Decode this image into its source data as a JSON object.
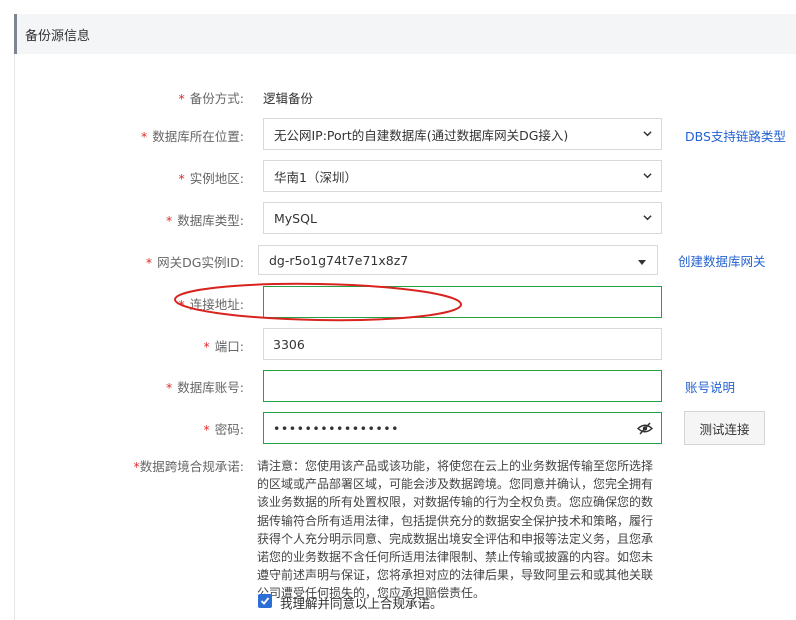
{
  "section": {
    "title": "备份源信息"
  },
  "form": {
    "backup_method": {
      "required": "*",
      "label": "备份方式:",
      "value": "逻辑备份"
    },
    "db_location": {
      "required": "*",
      "label": "数据库所在位置:",
      "value": "无公网IP:Port的自建数据库(通过数据库网关DG接入)",
      "link": "DBS支持链路类型"
    },
    "region": {
      "required": "*",
      "label": "实例地区:",
      "value": "华南1（深圳）"
    },
    "db_type": {
      "required": "*",
      "label": "数据库类型:",
      "value": "MySQL"
    },
    "gateway_id": {
      "required": "*",
      "label": "网关DG实例ID:",
      "value": "dg-r5o1g74t7e71x8z7",
      "link": "创建数据库网关"
    },
    "address": {
      "required": "*",
      "label": "连接地址:",
      "value": ""
    },
    "port": {
      "required": "*",
      "label": "端口:",
      "value": "3306"
    },
    "account": {
      "required": "*",
      "label": "数据库账号:",
      "value": "",
      "link": "账号说明"
    },
    "password": {
      "required": "*",
      "label": "密码:",
      "value": "••••••••••••••••"
    },
    "test_button": "测试连接",
    "compliance": {
      "required": "*",
      "label": "数据跨境合规承诺:",
      "text": "请注意：您使用该产品或该功能，将使您在云上的业务数据传输至您所选择的区域或产品部署区域，可能会涉及数据跨境。您同意并确认，您完全拥有该业务数据的所有处置权限，对数据传输的行为全权负责。您应确保您的数据传输符合所有适用法律，包括提供充分的数据安全保护技术和策略，履行获得个人充分明示同意、完成数据出境安全评估和申报等法定义务，且您承诺您的业务数据不含任何所适用法律限制、禁止传输或披露的内容。如您未遵守前述声明与保证，您将承担对应的法律后果，导致阿里云和或其他关联公司遭受任何损失的，您应承担赔偿责任。",
      "checkbox_checked": true,
      "checkbox_label": "我理解并同意以上合规承诺。"
    }
  },
  "colors": {
    "required": "#e02b2b",
    "link": "#2463d1",
    "valid_border": "#27a044",
    "annotation": "#d9231f",
    "checkbox": "#2b6fd6"
  }
}
